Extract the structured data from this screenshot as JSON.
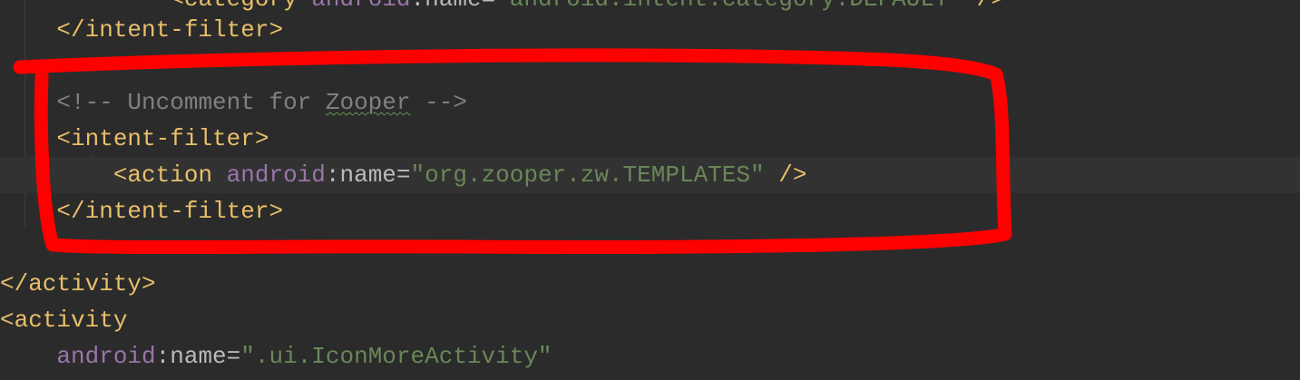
{
  "code": {
    "line_cut": {
      "tag": "<category",
      "ns": "android",
      "colon": ":",
      "attr": "name",
      "eq": "=",
      "value": "\"android.intent.category.DEFAULT\"",
      "close": " />"
    },
    "line1": {
      "tag": "</intent-filter>"
    },
    "line2": {
      "comment_start": "<!-- Uncomment for ",
      "comment_word": "Zooper",
      "comment_end": " -->"
    },
    "line3": {
      "tag": "<intent-filter>"
    },
    "line4": {
      "tag": "<action",
      "ns": "android",
      "colon": ":",
      "attr": "name",
      "eq": "=",
      "value": "\"org.zooper.zw.TEMPLATES\"",
      "close": " />"
    },
    "line5": {
      "tag": "</intent-filter>"
    },
    "line6": {
      "tag": "</activity>"
    },
    "line7": {
      "tag": "<activity"
    },
    "line8": {
      "ns": "android",
      "colon": ":",
      "attr": "name",
      "eq": "=",
      "value": "\".ui.IconMoreActivity\""
    }
  },
  "annotation": {
    "color": "#ff0000"
  }
}
